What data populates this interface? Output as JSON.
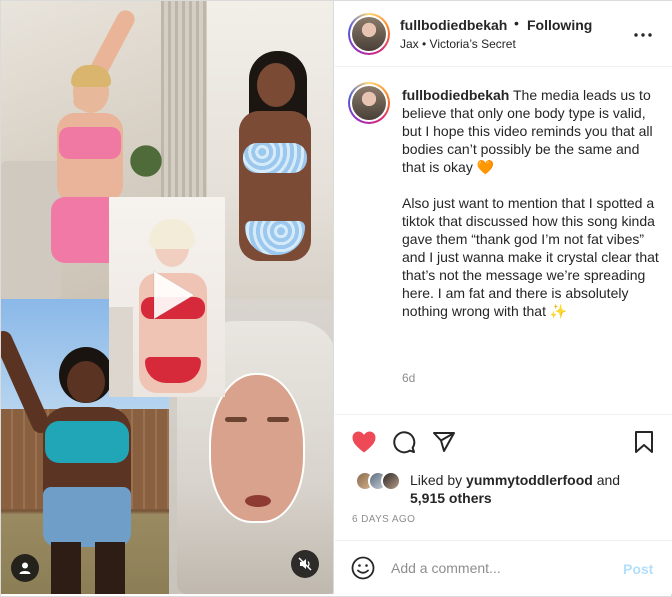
{
  "post": {
    "username": "fullbodiedbekah",
    "separator": "•",
    "follow_status": "Following",
    "location": "Jax • Victoria’s Secret",
    "caption_user": "fullbodiedbekah",
    "caption_text": " The media leads us to believe that only one body type is valid, but I hope this video reminds you that all bodies can’t possibly be the same and that is okay 🧡\n\nAlso just want to mention that I spotted a tiktok that discussed how this song kinda gave them “thank god I’m not fat vibes” and I just wanna make it crystal clear that that’s not the message we’re spreading here. I am fat and there is absolutely nothing wrong with that ✨",
    "age": "6d",
    "liked_prefix": "Liked by ",
    "liked_user": "yummytoddlerfood",
    "liked_and": " and",
    "liked_count": "5,915 others",
    "date": "6 DAYS AGO"
  },
  "comment": {
    "placeholder": "Add a comment...",
    "post_label": "Post"
  },
  "icons": {
    "more": "more-options-icon",
    "like": "heart-icon",
    "comment": "comment-icon",
    "share": "share-icon",
    "save": "bookmark-icon",
    "emoji": "emoji-icon",
    "play": "play-icon",
    "tagged_user": "user-icon",
    "mute": "mute-icon"
  },
  "colors": {
    "like_active": "#ed4956",
    "post_disabled": "#b2dffc",
    "secondary_text": "#8e8e8e"
  }
}
